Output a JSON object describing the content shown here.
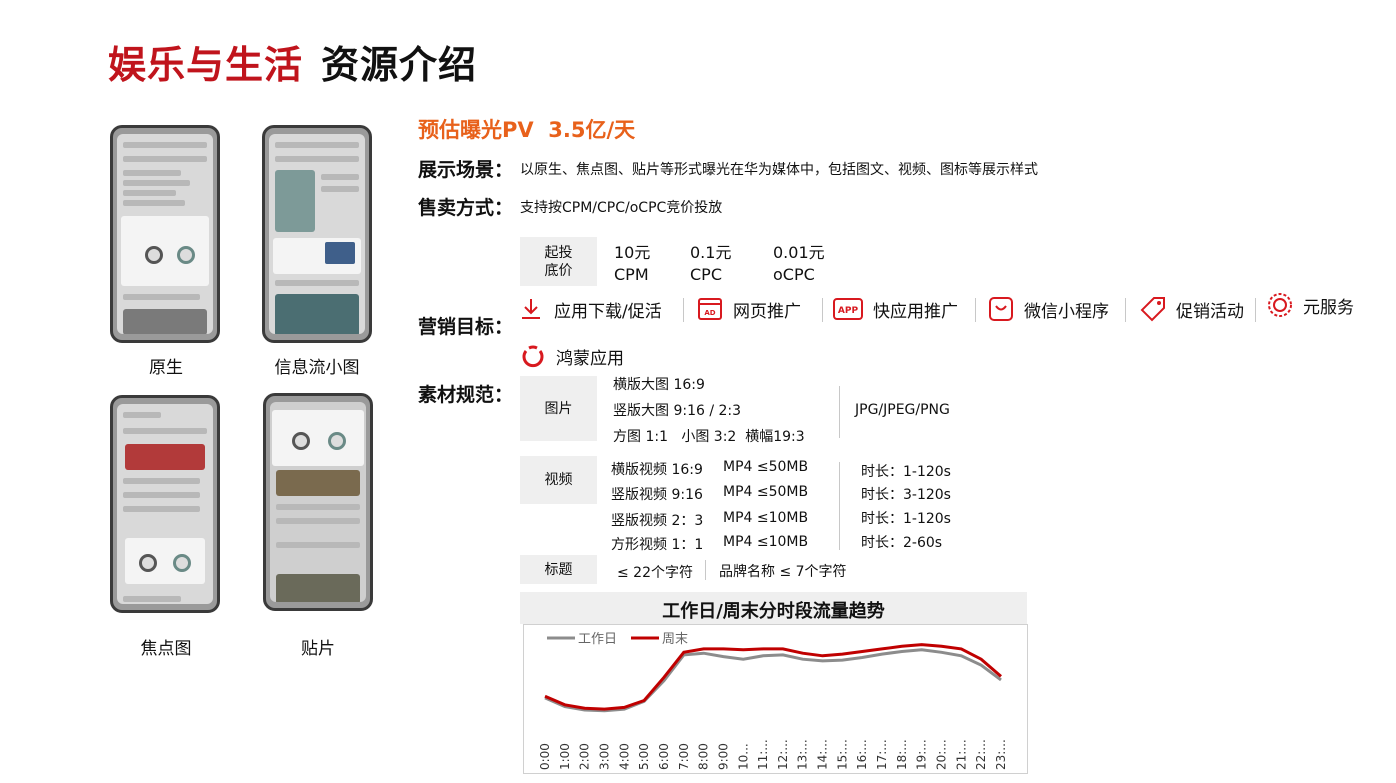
{
  "title": {
    "part1": "娱乐与生活",
    "part2": "资源介绍"
  },
  "phones": [
    {
      "caption": "原生"
    },
    {
      "caption": "信息流小图"
    },
    {
      "caption": "焦点图"
    },
    {
      "caption": "贴片"
    }
  ],
  "pv": "预估曝光PV  3.5亿/天",
  "scene": {
    "label": "展示场景：",
    "text": "以原生、焦点图、贴片等形式曝光在华为媒体中，包括图文、视频、图标等展示样式"
  },
  "sale": {
    "label": "售卖方式：",
    "text": "支持按CPM/CPC/oCPC竞价投放"
  },
  "price": {
    "label": "起投\n底价",
    "items": [
      {
        "value": "10元",
        "unit": "CPM"
      },
      {
        "value": "0.1元",
        "unit": "CPC"
      },
      {
        "value": "0.01元",
        "unit": "oCPC"
      }
    ]
  },
  "goals": {
    "label": "营销目标：",
    "items": [
      {
        "text": "应用下载/促活",
        "icon": "download-icon"
      },
      {
        "text": "网页推广",
        "icon": "webpage-icon"
      },
      {
        "text": "快应用推广",
        "icon": "app-icon"
      },
      {
        "text": "微信小程序",
        "icon": "mini-program-icon"
      },
      {
        "text": "促销活动",
        "icon": "tag-icon"
      },
      {
        "text": "元服务",
        "icon": "atomic-service-icon"
      },
      {
        "text": "鸿蒙应用",
        "icon": "harmony-icon"
      }
    ],
    "accent": "#d8191f"
  },
  "material": {
    "label": "素材规范：",
    "image": {
      "label": "图片",
      "lines": [
        "横版大图 16:9",
        "竖版大图 9:16 / 2:3",
        "方图 1:1   小图 3:2  横幅19:3"
      ],
      "format": "JPG/JPEG/PNG"
    },
    "video": {
      "label": "视频",
      "rows": [
        {
          "type": "横版视频 16:9",
          "spec": "MP4 ≤50MB",
          "dur": "时长：1-120s"
        },
        {
          "type": "竖版视频 9:16",
          "spec": "MP4 ≤50MB",
          "dur": "时长：3-120s"
        },
        {
          "type": "竖版视频 2：3",
          "spec": "MP4 ≤10MB",
          "dur": "时长：1-120s"
        },
        {
          "type": "方形视频 1：1",
          "spec": "MP4 ≤10MB",
          "dur": "时长：2-60s"
        }
      ]
    },
    "headline": {
      "label": "标题",
      "limit": "≤ 22个字符",
      "brand": "品牌名称 ≤ 7个字符"
    }
  },
  "chart_data": {
    "type": "line",
    "title": "工作日/周末分时段流量趋势",
    "categories": [
      "0:00",
      "1:00",
      "2:00",
      "3:00",
      "4:00",
      "5:00",
      "6:00",
      "7:00",
      "8:00",
      "9:00",
      "10...",
      "11:...",
      "12:...",
      "13:...",
      "14:...",
      "15:...",
      "16:...",
      "17:...",
      "18:...",
      "19:...",
      "20:...",
      "21:...",
      "22:...",
      "23:..."
    ],
    "series": [
      {
        "name": "工作日",
        "color": "#8c8c8c",
        "values": [
          28,
          18,
          14,
          13,
          15,
          24,
          48,
          78,
          80,
          76,
          73,
          77,
          78,
          73,
          71,
          72,
          75,
          79,
          82,
          84,
          81,
          77,
          66,
          49
        ]
      },
      {
        "name": "周末",
        "color": "#c00000",
        "values": [
          30,
          20,
          16,
          15,
          17,
          25,
          52,
          81,
          85,
          85,
          84,
          85,
          85,
          80,
          77,
          79,
          82,
          85,
          88,
          90,
          88,
          85,
          73,
          53
        ]
      }
    ],
    "ylim": [
      0,
      100
    ],
    "legend": "top-left",
    "grid": false
  }
}
